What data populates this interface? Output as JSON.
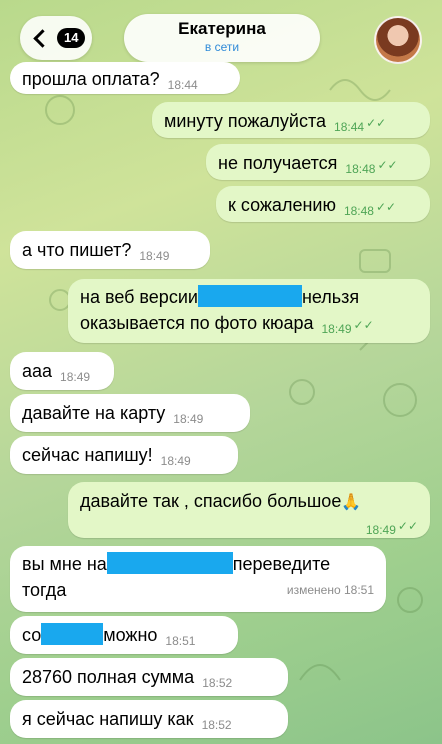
{
  "header": {
    "back_count": "14",
    "contact_name": "Екатерина",
    "status": "в сети",
    "avatar_alt": "avatar"
  },
  "messages": [
    {
      "dir": "in",
      "text": "прошла оплата?",
      "time": "18:44"
    },
    {
      "dir": "out",
      "text": "минуту пожалуйста",
      "time": "18:44"
    },
    {
      "dir": "out",
      "text": "не получается",
      "time": "18:48"
    },
    {
      "dir": "out",
      "text": "к сожалению",
      "time": "18:48"
    },
    {
      "dir": "in",
      "text": "а что пишет?",
      "time": "18:49"
    },
    {
      "dir": "out",
      "text_a": "на веб версии",
      "text_b": "нельзя",
      "text_c": "оказывается по фото кюара",
      "time": "18:49"
    },
    {
      "dir": "in",
      "text": "ааа",
      "time": "18:49"
    },
    {
      "dir": "in",
      "text": "давайте на карту",
      "time": "18:49"
    },
    {
      "dir": "in",
      "text": "сейчас напишу!",
      "time": "18:49"
    },
    {
      "dir": "out",
      "text": "давайте так , спасибо большое",
      "emoji": "🙏",
      "time": "18:49"
    },
    {
      "dir": "in",
      "text_a": "вы мне на",
      "text_b": "переведите",
      "text_c": "тогда",
      "edited": "изменено 18:51"
    },
    {
      "dir": "in",
      "text_a": "со",
      "text_b": "можно",
      "time": "18:51"
    },
    {
      "dir": "in",
      "text": "28760 полная сумма",
      "time": "18:52"
    },
    {
      "dir": "in",
      "text": "я сейчас напишу как",
      "time": "18:52"
    }
  ],
  "colors": {
    "outgoing_bubble": "#e3f7c7",
    "incoming_bubble": "#ffffff",
    "accent_blue": "#2f8ad8",
    "check_green": "#4fa556",
    "redaction": "#19a8ee"
  },
  "icons": [
    "chevron-left-icon",
    "double-check-icon",
    "folded-hands-emoji"
  ]
}
